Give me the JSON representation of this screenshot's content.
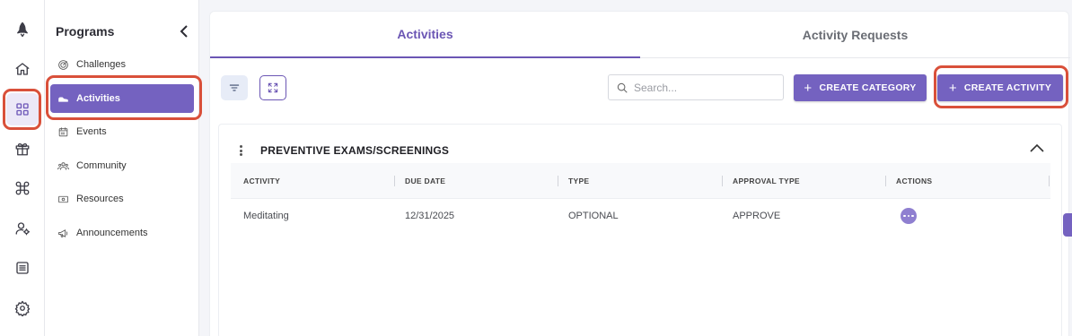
{
  "rail": {
    "items": [
      {
        "icon": "rocket-icon",
        "active": false
      },
      {
        "icon": "home-icon",
        "active": false
      },
      {
        "icon": "grid-icon",
        "active": true
      },
      {
        "icon": "gift-icon",
        "active": false
      },
      {
        "icon": "command-icon",
        "active": false
      },
      {
        "icon": "user-settings-icon",
        "active": false
      },
      {
        "icon": "list-icon",
        "active": false
      },
      {
        "icon": "settings-icon",
        "active": false
      }
    ]
  },
  "sidebar": {
    "title": "Programs",
    "items": [
      {
        "label": "Challenges",
        "icon": "target-icon",
        "active": false
      },
      {
        "label": "Activities",
        "icon": "shoe-icon",
        "active": true
      },
      {
        "label": "Events",
        "icon": "calendar-icon",
        "active": false
      },
      {
        "label": "Community",
        "icon": "people-icon",
        "active": false
      },
      {
        "label": "Resources",
        "icon": "resource-icon",
        "active": false
      },
      {
        "label": "Announcements",
        "icon": "megaphone-icon",
        "active": false
      }
    ]
  },
  "tabs": [
    {
      "label": "Activities",
      "active": true
    },
    {
      "label": "Activity Requests",
      "active": false
    }
  ],
  "toolbar": {
    "search_placeholder": "Search...",
    "create_category_label": "CREATE CATEGORY",
    "create_activity_label": "CREATE ACTIVITY"
  },
  "category": {
    "title": "PREVENTIVE EXAMS/SCREENINGS",
    "columns": [
      "ACTIVITY",
      "DUE DATE",
      "TYPE",
      "APPROVAL TYPE",
      "ACTIONS"
    ],
    "rows": [
      {
        "activity": "Meditating",
        "due_date": "12/31/2025",
        "type": "OPTIONAL",
        "approval_type": "APPROVE"
      }
    ]
  },
  "colors": {
    "accent": "#7462c0",
    "highlight": "#d9503a",
    "active_tab": "#6b56b4"
  }
}
